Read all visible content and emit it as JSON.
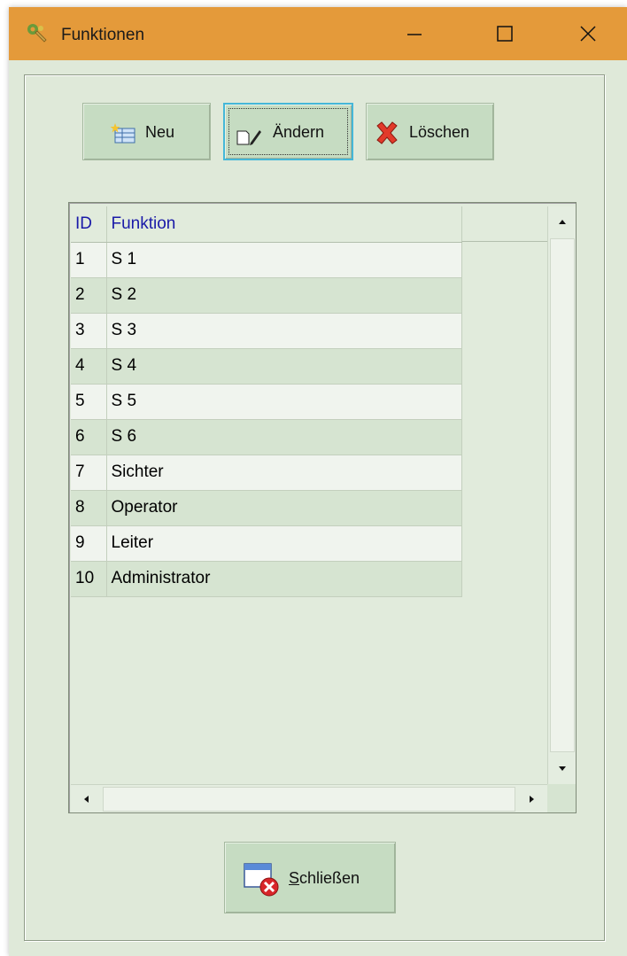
{
  "window": {
    "title": "Funktionen",
    "icon": "gear-wrench-icon",
    "controls": [
      "minimize-icon",
      "maximize-icon",
      "close-icon"
    ]
  },
  "toolbar": {
    "new_label": "Neu",
    "edit_label": "Ändern",
    "delete_label": "Löschen",
    "new_icon": "new-table-icon",
    "edit_icon": "edit-document-icon",
    "delete_icon": "red-x-icon"
  },
  "grid": {
    "columns": [
      "ID",
      "Funktion"
    ],
    "rows": [
      {
        "id": "1",
        "funktion": "S 1"
      },
      {
        "id": "2",
        "funktion": "S 2"
      },
      {
        "id": "3",
        "funktion": "S 3"
      },
      {
        "id": "4",
        "funktion": "S 4"
      },
      {
        "id": "5",
        "funktion": "S 5"
      },
      {
        "id": "6",
        "funktion": "S 6"
      },
      {
        "id": "7",
        "funktion": "Sichter"
      },
      {
        "id": "8",
        "funktion": "Operator"
      },
      {
        "id": "9",
        "funktion": "Leiter"
      },
      {
        "id": "10",
        "funktion": "Administrator"
      }
    ]
  },
  "footer": {
    "close_label": "Schließen",
    "close_icon": "window-close-icon"
  },
  "colors": {
    "titlebar": "#e49a3a",
    "background": "#dfe9d9",
    "button": "#c6dcc2",
    "header_text": "#1a1aa8",
    "focus_border": "#45b7d8"
  }
}
